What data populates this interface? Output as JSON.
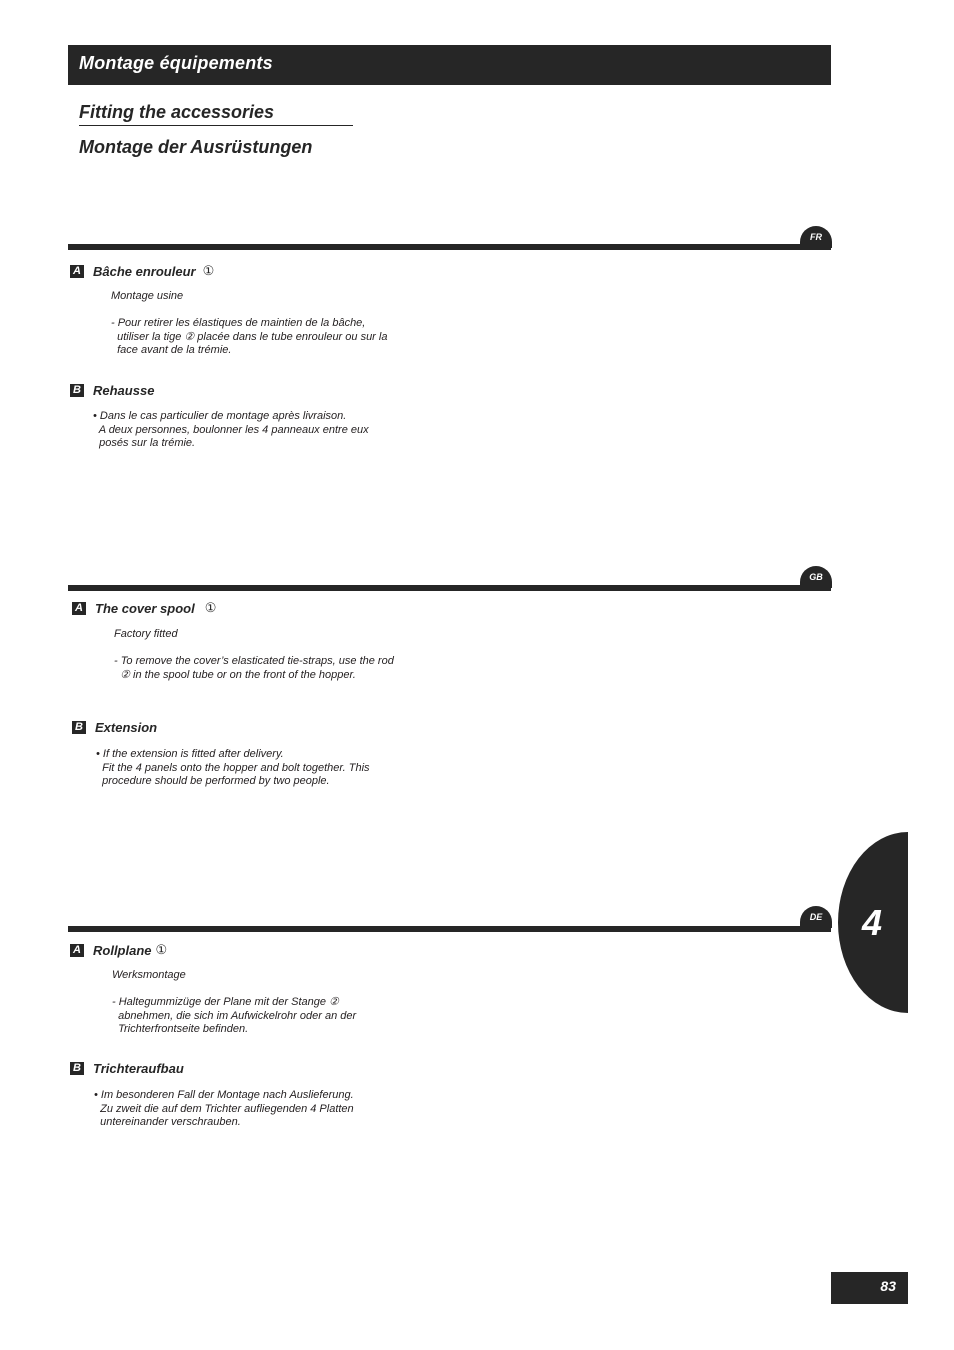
{
  "header": {
    "title_fr": "Montage équipements",
    "title_gb": "Fitting the accessories",
    "title_de": "Montage der Ausrüstungen"
  },
  "sections": [
    {
      "lang": "FR",
      "a": {
        "letter": "A",
        "title": "Bâche enrouleur",
        "ref": "①",
        "intro": "Montage usine",
        "text": "- Pour retirer les élastiques de maintien de la bâche,\n  utiliser la tige ② placée dans le tube enrouleur ou sur la\n  face avant de la trémie."
      },
      "b": {
        "letter": "B",
        "title": "Rehausse",
        "text": "• Dans le cas particulier de montage après livraison.\n  A deux personnes, boulonner les 4 panneaux entre eux\n  posés sur la trémie."
      }
    },
    {
      "lang": "GB",
      "a": {
        "letter": "A",
        "title": "The cover spool",
        "ref": "①",
        "intro": "Factory fitted",
        "text": "- To remove the cover’s elasticated tie-straps, use the rod\n  ② in the spool tube or on the front of the hopper."
      },
      "b": {
        "letter": "B",
        "title": "Extension",
        "text": "• If the extension is fitted after delivery.\n  Fit the 4 panels onto the hopper and bolt together. This\n  procedure should be performed by two people."
      }
    },
    {
      "lang": "DE",
      "a": {
        "letter": "A",
        "title": "Rollplane",
        "ref": "①",
        "intro": "Werksmontage",
        "text": "- Haltegummizüge der Plane mit der Stange ②\n  abnehmen, die sich im Aufwickelrohr oder an der\n  Trichterfrontseite befinden."
      },
      "b": {
        "letter": "B",
        "title": "Trichteraufbau",
        "text": "• Im besonderen Fall der Montage nach Auslieferung.\n  Zu zweit die auf dem Trichter aufliegenden 4 Platten\n  untereinander verschrauben."
      }
    }
  ],
  "chapter": "4",
  "page_number": "83"
}
